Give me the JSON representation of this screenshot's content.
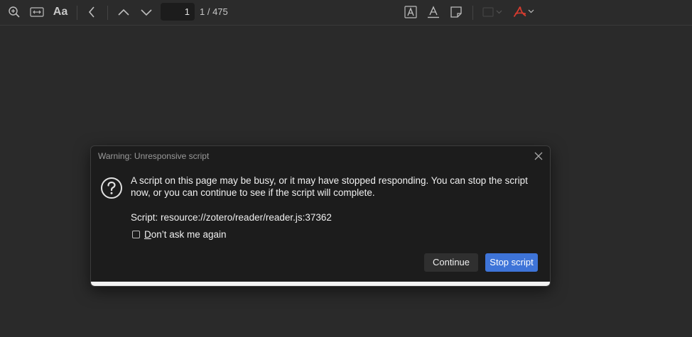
{
  "toolbar": {
    "zoom_icon": "zoom-in-icon",
    "fit_width_icon": "fit-width-icon",
    "text_size_label": "Aa",
    "page_number": "1",
    "page_count": "1 / 475",
    "pdf_color": "#d63b2f"
  },
  "dialog": {
    "title": "Warning: Unresponsive script",
    "message": "A script on this page may be busy, or it may have stopped responding. You can stop the script now, or you can continue to see if the script will complete.",
    "script_line": "Script: resource://zotero/reader/reader.js:37362",
    "checkbox_underlined": "D",
    "checkbox_rest": "on’t ask me again",
    "checkbox_checked": false,
    "continue_label": "Continue",
    "stop_label": "Stop script",
    "accent_color": "#3e74d8"
  }
}
